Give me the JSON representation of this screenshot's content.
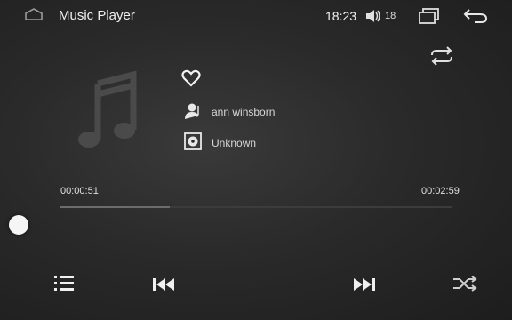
{
  "header": {
    "title": "Music Player",
    "clock": "18:23",
    "volume_level": "18"
  },
  "track": {
    "title": "",
    "artist": "ann winsborn",
    "album": "Unknown"
  },
  "progress": {
    "current_time": "00:00:51",
    "total_time": "00:02:59",
    "fraction": 0.28
  },
  "icons": {
    "home": "home-icon",
    "volume": "volume-icon",
    "recent_apps": "recent-apps-icon",
    "back": "back-icon",
    "repeat": "repeat-icon",
    "album_art": "music-note-icon",
    "favorite": "heart-icon",
    "artist": "artist-icon",
    "album": "album-icon",
    "playlist": "playlist-icon",
    "previous": "previous-track-icon",
    "next": "next-track-icon",
    "shuffle": "shuffle-icon"
  },
  "colors": {
    "background": "#2a2a2a",
    "text": "#e8e8e8",
    "progress_fill": "#6c6c6c"
  }
}
